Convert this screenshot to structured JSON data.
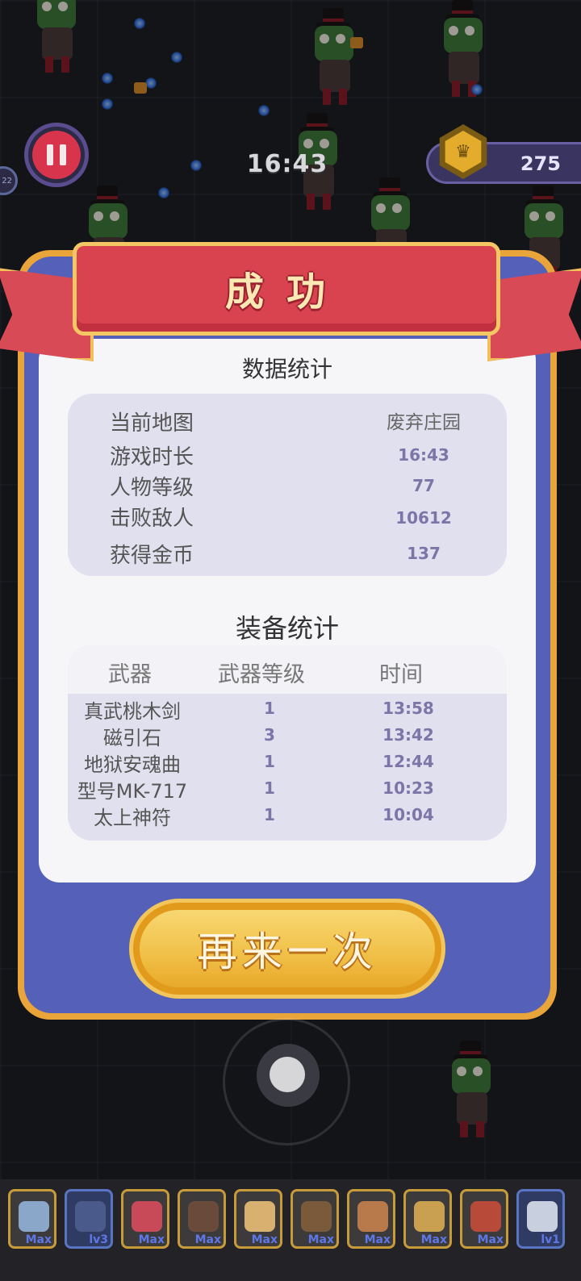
{
  "hud": {
    "timer": "16:43",
    "coins": "275",
    "left_badge": "22"
  },
  "result": {
    "title": "成功",
    "stats_title": "数据统计",
    "stats": [
      {
        "label": "当前地图",
        "value": "废弃庄园"
      },
      {
        "label": "游戏时长",
        "value": "16:43"
      },
      {
        "label": "人物等级",
        "value": "77"
      },
      {
        "label": "击败敌人",
        "value": "10612"
      },
      {
        "label": "获得金币",
        "value": "137"
      }
    ],
    "equip_title": "装备统计",
    "equip_headers": {
      "weapon": "武器",
      "level": "武器等级",
      "time": "时间"
    },
    "equipment": [
      {
        "name": "真武桃木剑",
        "level": "1",
        "time": "13:58"
      },
      {
        "name": "磁引石",
        "level": "3",
        "time": "13:42"
      },
      {
        "name": "地狱安魂曲",
        "level": "1",
        "time": "12:44"
      },
      {
        "name": "型号MK-717",
        "level": "1",
        "time": "10:23"
      },
      {
        "name": "太上神符",
        "level": "1",
        "time": "10:04"
      }
    ],
    "retry_label": "再来一次"
  },
  "skills": [
    {
      "icon": "sword-icon",
      "level": "Max",
      "color": "#8aa6c8"
    },
    {
      "icon": "spirit-icon",
      "level": "lv3",
      "color": "#4a5a8a"
    },
    {
      "icon": "magnet-ring-icon",
      "level": "Max",
      "color": "#c84a58"
    },
    {
      "icon": "cannon-icon",
      "level": "Max",
      "color": "#6a4a3a"
    },
    {
      "icon": "scroll-icon",
      "level": "Max",
      "color": "#d8b070"
    },
    {
      "icon": "shield-icon",
      "level": "Max",
      "color": "#7a5a3a"
    },
    {
      "icon": "fist-icon",
      "level": "Max",
      "color": "#b87a4a"
    },
    {
      "icon": "treasure-icon",
      "level": "Max",
      "color": "#c8a050"
    },
    {
      "icon": "dagger-icon",
      "level": "Max",
      "color": "#b84a3a"
    },
    {
      "icon": "staff-icon",
      "level": "lv1",
      "color": "#c8d0e0"
    }
  ]
}
